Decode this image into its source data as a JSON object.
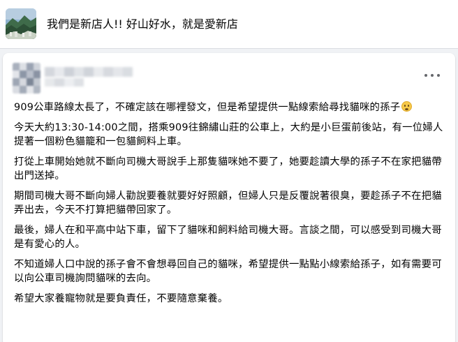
{
  "group": {
    "name": "我們是新店人!! 好山好水，就是愛新店",
    "thumbnail_icon": "mountain-landscape-photo"
  },
  "post": {
    "author_name": "",
    "menu_icon": "more-options-dots-icon",
    "paragraphs": [
      "909公車路線太長了，不確定該在哪裡發文，但是希望提供一點線索給尋找貓咪的孫子",
      "今天大約13:30-14:00之間，搭乘909往錦繡山莊的公車上，大約是小巨蛋前後站，有一位婦人提著一個粉色貓籠和一包貓飼料上車。",
      "打從上車開始她就不斷向司機大哥說手上那隻貓咪她不要了，她要趁讀大學的孫子不在家把貓帶出門送掉。",
      "期間司機大哥不斷向婦人勸說要養就要好好照顧，但婦人只是反覆說著很臭，要趁孫子不在把貓弄出去，今天不打算把貓帶回家了。",
      "最後，婦人在和平高中站下車，留下了貓咪和飼料給司機大哥。言談之間，可以感受到司機大哥是有愛心的人。",
      "不知道婦人口中說的孫子會不會想尋回自己的貓咪，希望提供一點點小線索給孫子，如有需要可以向公車司機詢問貓咪的去向。",
      "希望大家養寵物就是要負責任，不要隨意棄養。"
    ],
    "first_paragraph_emoji": "grimacing-face-emoji"
  },
  "colors": {
    "page_bg": "#f0f2f5",
    "card_bg": "#ffffff",
    "text": "#050505",
    "muted": "#65676b"
  }
}
